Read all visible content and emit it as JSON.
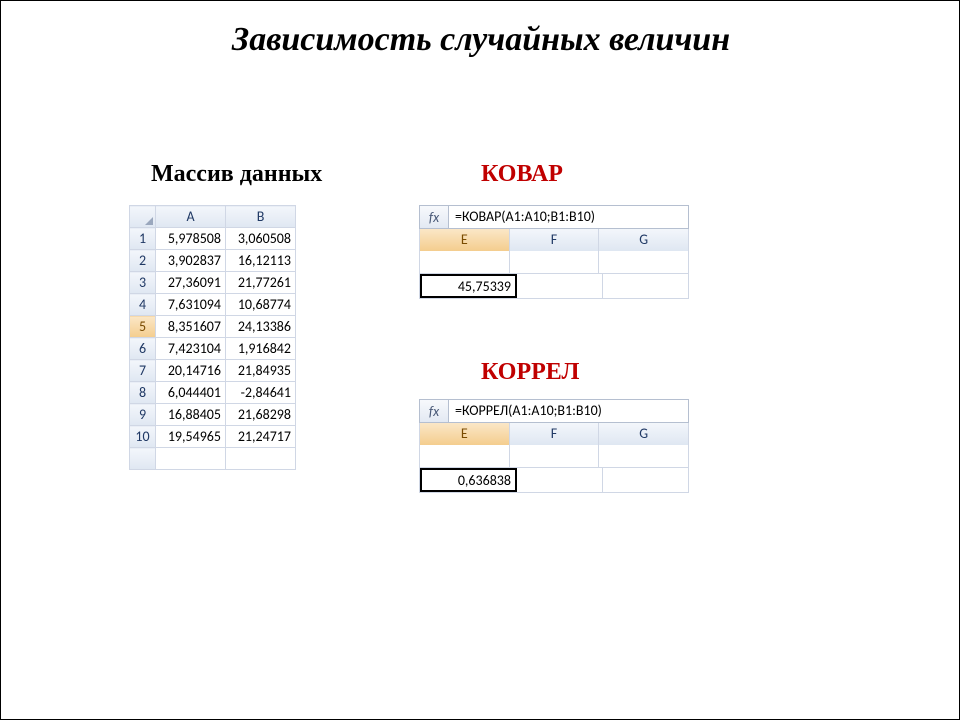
{
  "title": "Зависимость случайных величин",
  "subtitles": {
    "data": "Массив данных",
    "covar": "КОВАР",
    "correl": "КОРРЕЛ"
  },
  "data_table": {
    "columns": [
      "A",
      "B"
    ],
    "selected_row": 5,
    "rows": [
      {
        "n": "1",
        "a": "5,978508",
        "b": "3,060508"
      },
      {
        "n": "2",
        "a": "3,902837",
        "b": "16,12113"
      },
      {
        "n": "3",
        "a": "27,36091",
        "b": "21,77261"
      },
      {
        "n": "4",
        "a": "7,631094",
        "b": "10,68774"
      },
      {
        "n": "5",
        "a": "8,351607",
        "b": "24,13386"
      },
      {
        "n": "6",
        "a": "7,423104",
        "b": "1,916842"
      },
      {
        "n": "7",
        "a": "20,14716",
        "b": "21,84935"
      },
      {
        "n": "8",
        "a": "6,044401",
        "b": "-2,84641"
      },
      {
        "n": "9",
        "a": "16,88405",
        "b": "21,68298"
      },
      {
        "n": "10",
        "a": "19,54965",
        "b": "21,24717"
      }
    ]
  },
  "covar": {
    "fx_label": "fx",
    "formula": "=КОВАР(A1:A10;B1:B10)",
    "columns": [
      "E",
      "F",
      "G"
    ],
    "selected_col": "E",
    "result": "45,75339"
  },
  "correl": {
    "fx_label": "fx",
    "formula": "=КОРРЕЛ(A1:A10;B1:B10)",
    "columns": [
      "E",
      "F",
      "G"
    ],
    "selected_col": "E",
    "result": "0,636838"
  }
}
